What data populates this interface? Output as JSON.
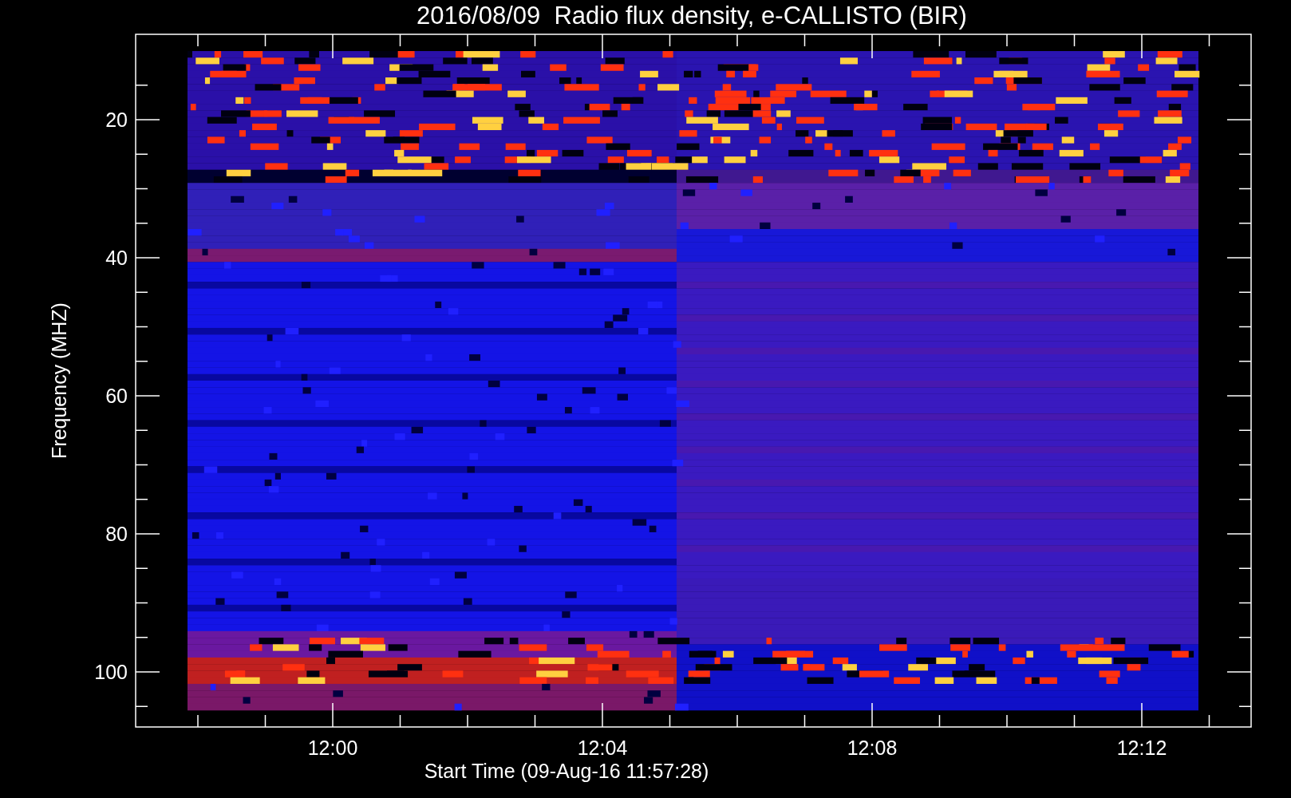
{
  "title": "2016/08/09  Radio flux density, e-CALLISTO (BIR)",
  "y_axis": {
    "title": "Frequency (MHZ)",
    "tick_labels": [
      "20",
      "40",
      "60",
      "80",
      "100"
    ]
  },
  "x_axis": {
    "title": "Start Time (09-Aug-16 11:57:28)",
    "tick_labels": [
      "12:00",
      "12:04",
      "12:08",
      "12:12"
    ]
  }
}
